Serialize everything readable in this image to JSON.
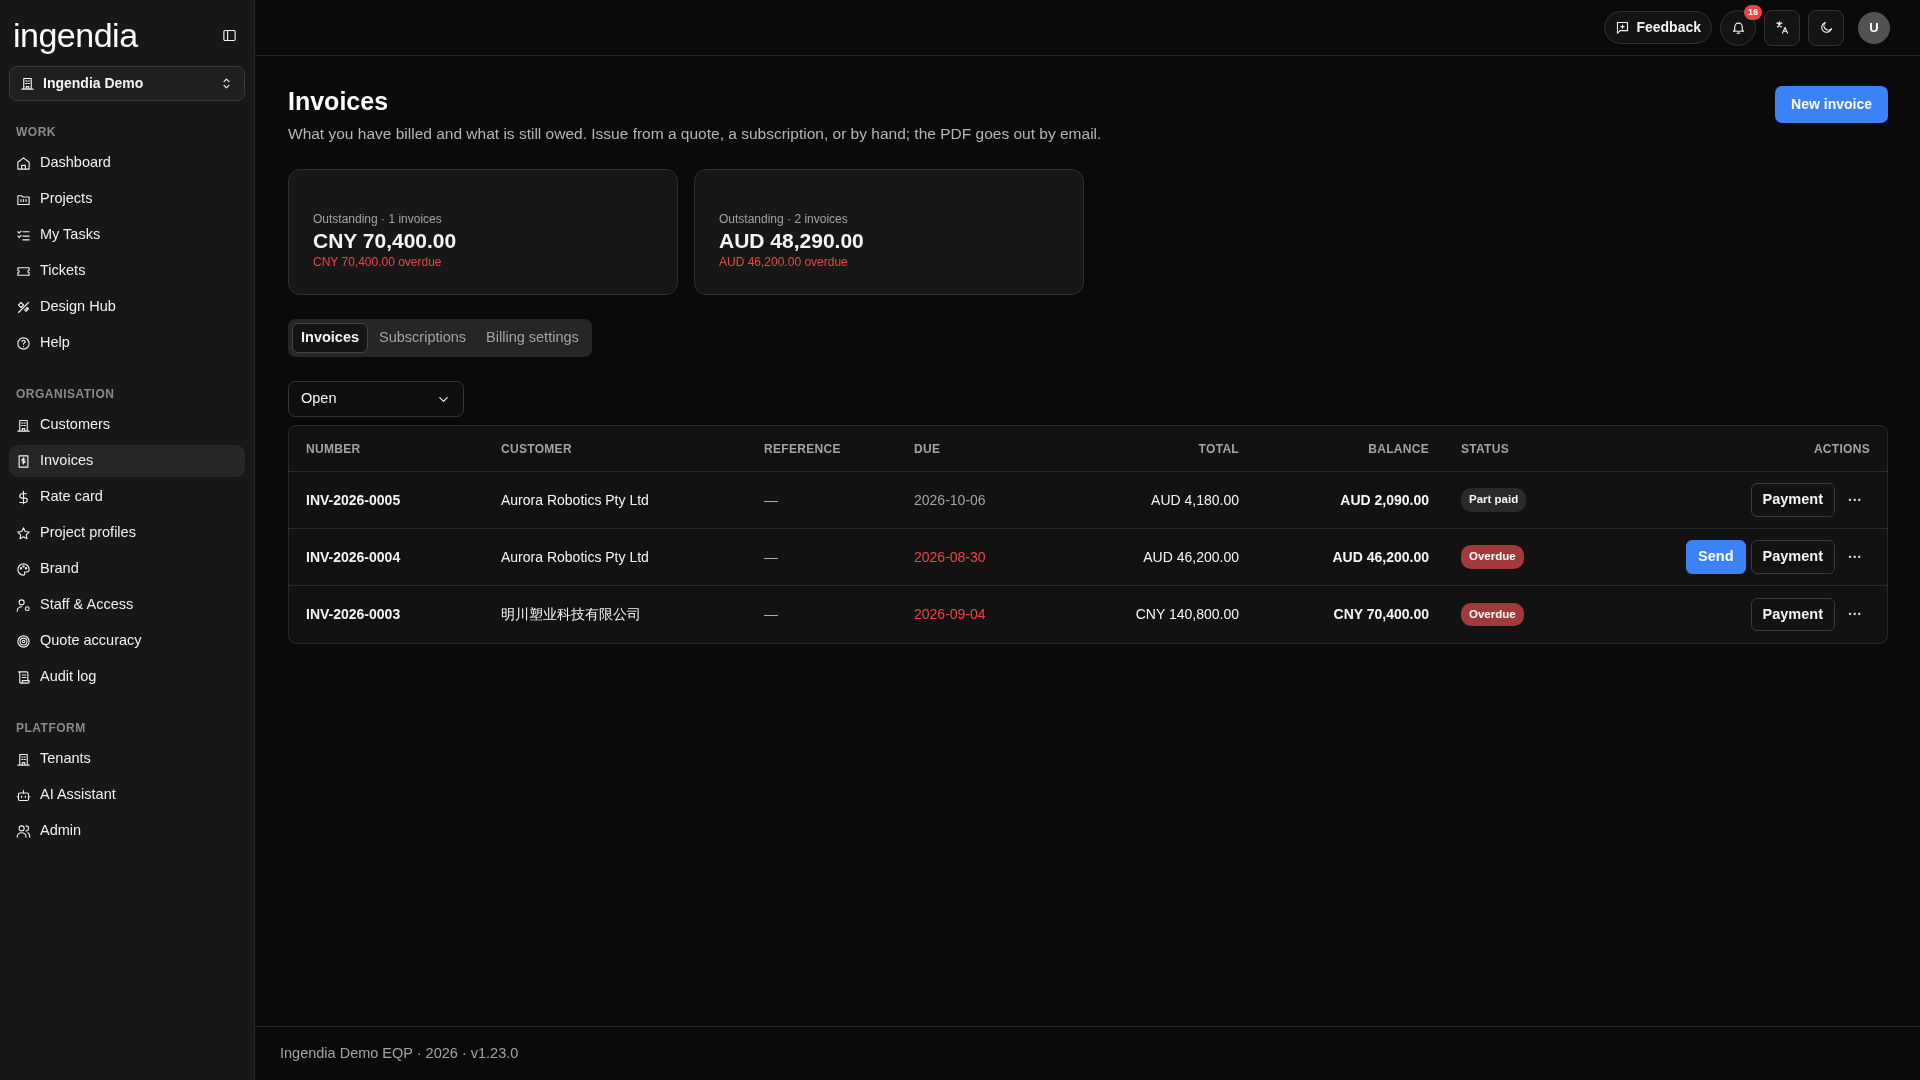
{
  "brand": {
    "logo": "ingendia"
  },
  "workspace": {
    "name": "Ingendia Demo"
  },
  "sidebar": {
    "sections": [
      {
        "heading": "WORK",
        "items": [
          {
            "label": "Dashboard",
            "selected": false
          },
          {
            "label": "Projects",
            "selected": false
          },
          {
            "label": "My Tasks",
            "selected": false
          },
          {
            "label": "Tickets",
            "selected": false
          },
          {
            "label": "Design Hub",
            "selected": false
          },
          {
            "label": "Help",
            "selected": false
          }
        ]
      },
      {
        "heading": "ORGANISATION",
        "items": [
          {
            "label": "Customers",
            "selected": false
          },
          {
            "label": "Invoices",
            "selected": true
          },
          {
            "label": "Rate card",
            "selected": false
          },
          {
            "label": "Project profiles",
            "selected": false
          },
          {
            "label": "Brand",
            "selected": false
          },
          {
            "label": "Staff & Access",
            "selected": false
          },
          {
            "label": "Quote accuracy",
            "selected": false
          },
          {
            "label": "Audit log",
            "selected": false
          }
        ]
      },
      {
        "heading": "PLATFORM",
        "items": [
          {
            "label": "Tenants",
            "selected": false
          },
          {
            "label": "AI Assistant",
            "selected": false
          },
          {
            "label": "Admin",
            "selected": false
          }
        ]
      }
    ]
  },
  "topbar": {
    "feedback": "Feedback",
    "notifications": "16",
    "avatar": "U"
  },
  "page": {
    "title": "Invoices",
    "subtitle": "What you have billed and what is still owed. Issue from a quote, a subscription, or by hand; the PDF goes out by email.",
    "new_button": "New invoice"
  },
  "summary_cards": [
    {
      "caption": "Outstanding · 1 invoices",
      "amount": "CNY 70,400.00",
      "overdue": "CNY 70,400.00 overdue"
    },
    {
      "caption": "Outstanding · 2 invoices",
      "amount": "AUD 48,290.00",
      "overdue": "AUD 46,200.00 overdue"
    }
  ],
  "tabs": [
    {
      "label": "Invoices",
      "selected": true
    },
    {
      "label": "Subscriptions",
      "selected": false
    },
    {
      "label": "Billing settings",
      "selected": false
    }
  ],
  "filter": {
    "value": "Open"
  },
  "table": {
    "columns": [
      "NUMBER",
      "CUSTOMER",
      "REFERENCE",
      "DUE",
      "TOTAL",
      "BALANCE",
      "STATUS",
      "ACTIONS"
    ],
    "rows": [
      {
        "number": "INV-2026-0005",
        "customer": "Aurora Robotics Pty Ltd",
        "reference": "—",
        "due": "2026-10-06",
        "overdue": false,
        "total": "AUD 4,180.00",
        "balance": "AUD 2,090.00",
        "status": {
          "label": "Part paid",
          "kind": "neutral"
        },
        "actions": [
          {
            "label": "Payment",
            "kind": "secondary"
          }
        ],
        "more": "···"
      },
      {
        "number": "INV-2026-0004",
        "customer": "Aurora Robotics Pty Ltd",
        "reference": "—",
        "due": "2026-08-30",
        "overdue": true,
        "total": "AUD 46,200.00",
        "balance": "AUD 46,200.00",
        "status": {
          "label": "Overdue",
          "kind": "danger"
        },
        "actions": [
          {
            "label": "Send",
            "kind": "primary"
          },
          {
            "label": "Payment",
            "kind": "secondary"
          }
        ],
        "more": "···"
      },
      {
        "number": "INV-2026-0003",
        "customer": "明川塑业科技有限公司",
        "reference": "—",
        "due": "2026-09-04",
        "overdue": true,
        "total": "CNY 140,800.00",
        "balance": "CNY 70,400.00",
        "status": {
          "label": "Overdue",
          "kind": "danger"
        },
        "actions": [
          {
            "label": "Payment",
            "kind": "secondary"
          }
        ],
        "more": "···"
      }
    ]
  },
  "footer": "Ingendia Demo EQP · 2026 · v1.23.0"
}
